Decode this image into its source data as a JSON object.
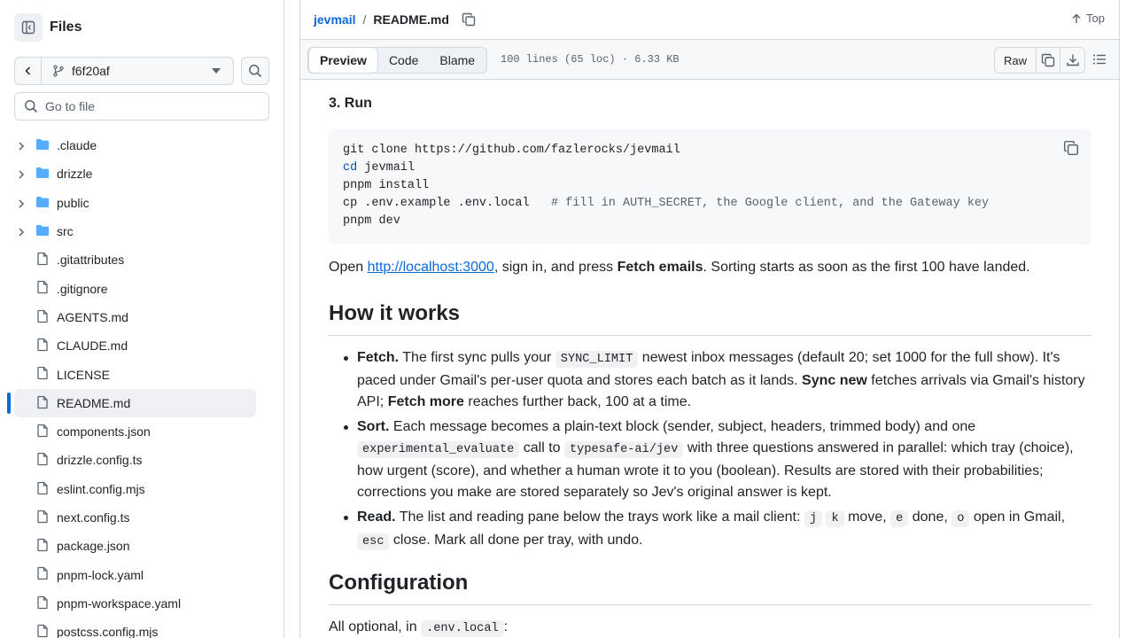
{
  "sidebar": {
    "title": "Files",
    "branch": "f6f20af",
    "goto_placeholder": "Go to file",
    "items": [
      {
        "name": ".claude",
        "type": "folder"
      },
      {
        "name": "drizzle",
        "type": "folder"
      },
      {
        "name": "public",
        "type": "folder"
      },
      {
        "name": "src",
        "type": "folder"
      },
      {
        "name": ".gitattributes",
        "type": "file"
      },
      {
        "name": ".gitignore",
        "type": "file"
      },
      {
        "name": "AGENTS.md",
        "type": "file"
      },
      {
        "name": "CLAUDE.md",
        "type": "file"
      },
      {
        "name": "LICENSE",
        "type": "file"
      },
      {
        "name": "README.md",
        "type": "file",
        "selected": true
      },
      {
        "name": "components.json",
        "type": "file"
      },
      {
        "name": "drizzle.config.ts",
        "type": "file"
      },
      {
        "name": "eslint.config.mjs",
        "type": "file"
      },
      {
        "name": "next.config.ts",
        "type": "file"
      },
      {
        "name": "package.json",
        "type": "file"
      },
      {
        "name": "pnpm-lock.yaml",
        "type": "file"
      },
      {
        "name": "pnpm-workspace.yaml",
        "type": "file"
      },
      {
        "name": "postcss.config.mjs",
        "type": "file"
      }
    ]
  },
  "header": {
    "repo": "jevmail",
    "separator": "/",
    "file": "README.md",
    "top_label": "Top"
  },
  "toolbar": {
    "tabs": [
      "Preview",
      "Code",
      "Blame"
    ],
    "active_tab": "Preview",
    "meta": "100 lines (65 loc) · 6.33 KB",
    "raw_label": "Raw"
  },
  "content": {
    "run_heading": "3. Run",
    "code": {
      "line1": "git clone https://github.com/fazlerocks/jevmail",
      "line2_kw": "cd",
      "line2_rest": " jevmail",
      "line3": "pnpm install",
      "line4_cmd": "cp .env.example .env.local   ",
      "line4_comment": "# fill in AUTH_SECRET, the Google client, and the Gateway key",
      "line5": "pnpm dev"
    },
    "open_para": {
      "pre": "Open ",
      "link": "http://localhost:3000",
      "mid": ", sign in, and press ",
      "bold": "Fetch emails",
      "post": ". Sorting starts as soon as the first 100 have landed."
    },
    "how_heading": "How it works",
    "bullet_fetch": {
      "title": "Fetch.",
      "t1": " The first sync pulls your ",
      "code1": "SYNC_LIMIT",
      "t2": " newest inbox messages (default 20; set 1000 for the full show). It's paced under Gmail's per-user quota and stores each batch as it lands. ",
      "b1": "Sync new",
      "t3": " fetches arrivals via Gmail's history API; ",
      "b2": "Fetch more",
      "t4": " reaches further back, 100 at a time."
    },
    "bullet_sort": {
      "title": "Sort.",
      "t1": " Each message becomes a plain-text block (sender, subject, headers, trimmed body) and one ",
      "code1": "experimental_evaluate",
      "t2": " call to ",
      "code2": "typesafe-ai/jev",
      "t3": " with three questions answered in parallel: which tray (choice), how urgent (score), and whether a human wrote it to you (boolean). Results are stored with their probabilities; corrections you make are stored separately so Jev's original answer is kept."
    },
    "bullet_read": {
      "title": "Read.",
      "t1": " The list and reading pane below the trays work like a mail client: ",
      "k1": "j",
      "k2": "k",
      "t2": " move, ",
      "k3": "e",
      "t3": " done, ",
      "k4": "o",
      "t4": " open in Gmail, ",
      "k5": "esc",
      "t5": " close. Mark all done per tray, with undo."
    },
    "config_heading": "Configuration",
    "config_para": {
      "pre": "All optional, in ",
      "code": ".env.local",
      "post": ":"
    }
  }
}
